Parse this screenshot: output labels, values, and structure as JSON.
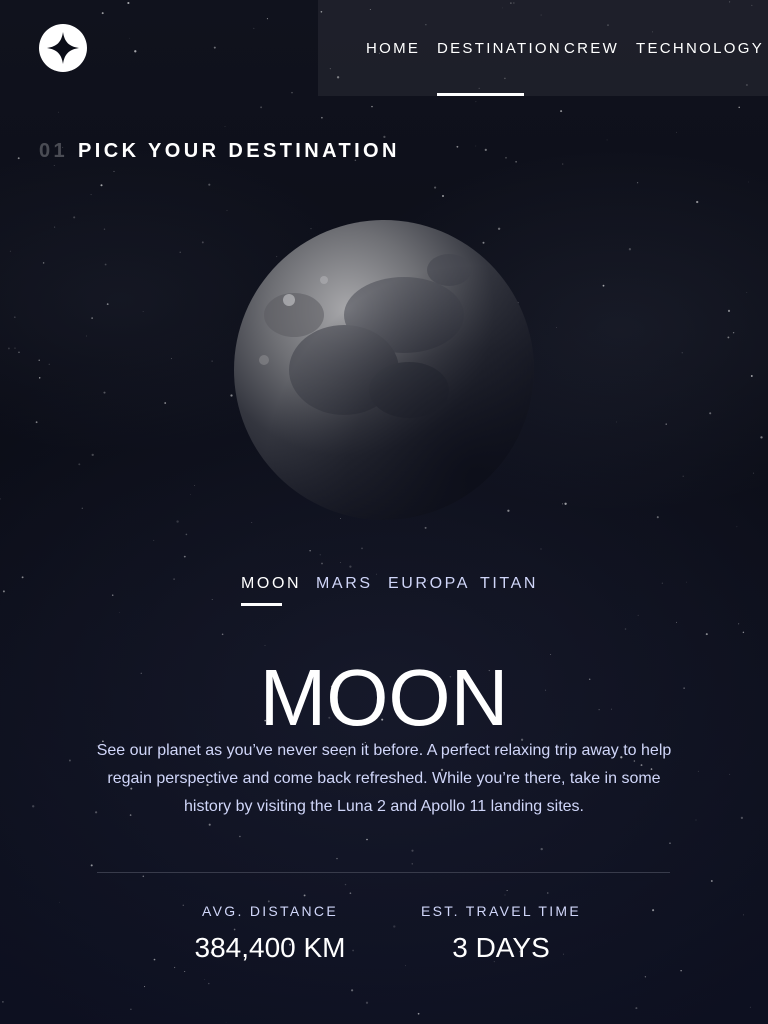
{
  "nav": {
    "items": [
      {
        "label": "HOME"
      },
      {
        "label": "DESTINATION",
        "active": true
      },
      {
        "label": "CREW"
      },
      {
        "label": "TECHNOLOGY"
      }
    ]
  },
  "page": {
    "number": "01",
    "title": "PICK YOUR DESTINATION"
  },
  "tabs": [
    {
      "label": "MOON",
      "active": true
    },
    {
      "label": "MARS"
    },
    {
      "label": "EUROPA"
    },
    {
      "label": "TITAN"
    }
  ],
  "destination": {
    "name": "MOON",
    "description": "See our planet as you’ve never seen it before. A perfect relaxing trip away to help regain perspective and come back refreshed. While you’re there, take in some history by visiting the Luna 2 and Apollo 11 landing sites."
  },
  "stats": {
    "distance_label": "AVG. DISTANCE",
    "distance_value": "384,400 KM",
    "travel_label": "EST. TRAVEL TIME",
    "travel_value": "3 DAYS"
  },
  "colors": {
    "background": "#0b0d17",
    "text_light": "#d0d6f9",
    "white": "#ffffff"
  },
  "icons": {
    "logo": "four-point-star-icon"
  }
}
